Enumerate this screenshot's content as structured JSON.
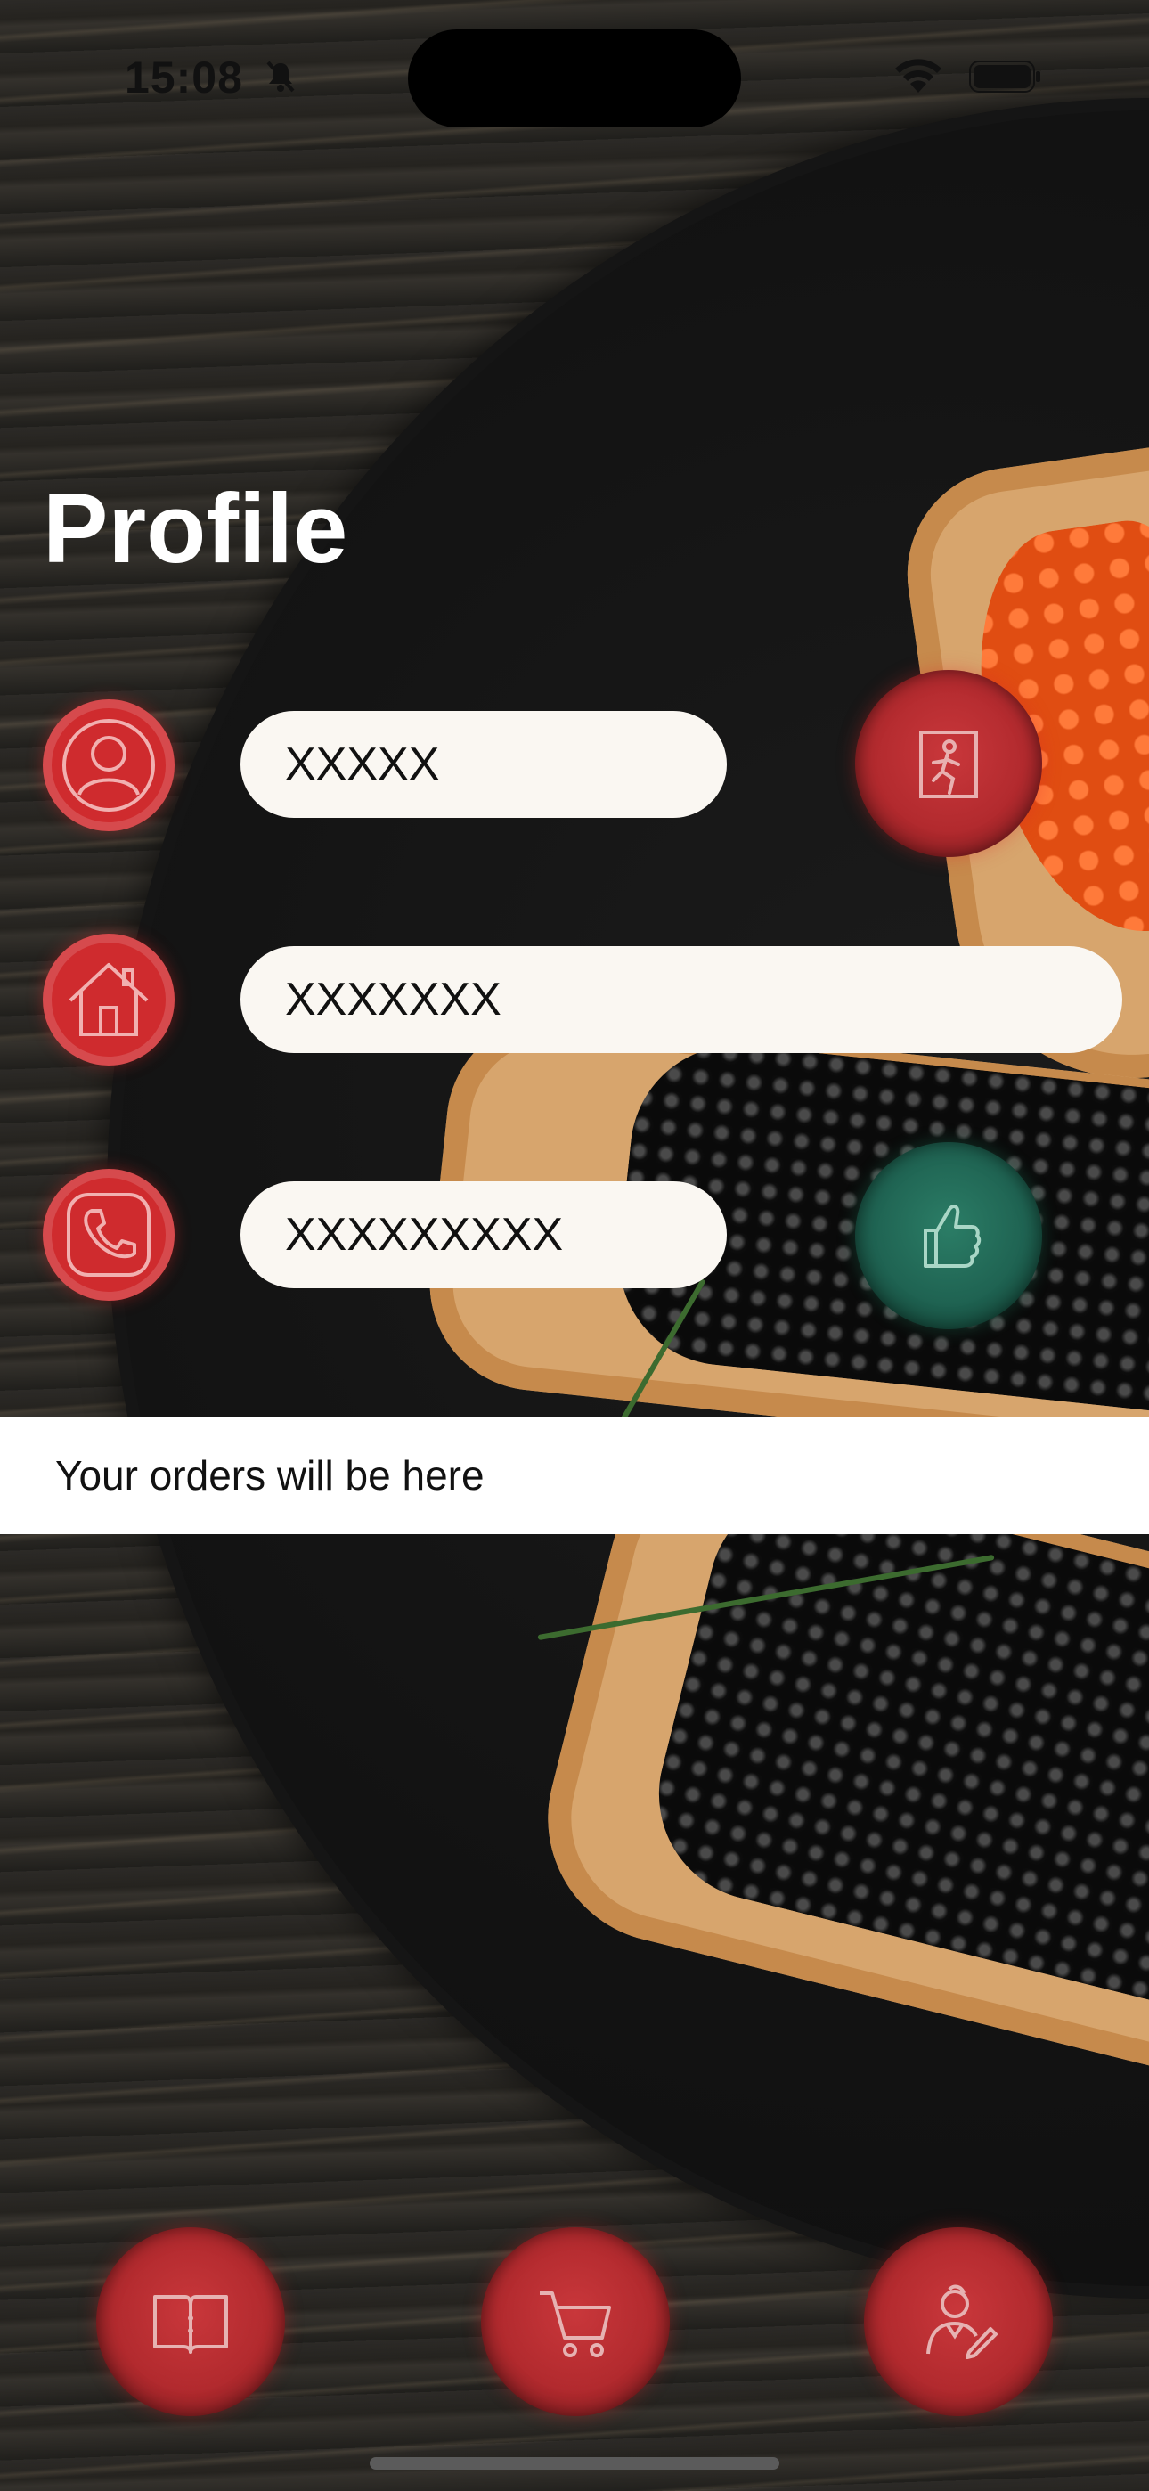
{
  "status_bar": {
    "time": "15:08"
  },
  "header": {
    "title": "Profile"
  },
  "profile": {
    "name_value": "XXXXX",
    "address_value": "XXXXXXX",
    "phone_value": "XXXXXXXXX"
  },
  "orders": {
    "empty_text": "Your orders will be here"
  },
  "icons": {
    "user": "user-icon",
    "home": "home-icon",
    "phone": "phone-icon",
    "exit": "exit-icon",
    "confirm": "thumbs-up-icon",
    "menu": "menu-book-icon",
    "cart": "cart-icon",
    "chef": "chef-icon"
  },
  "colors": {
    "accent_red": "#cf2b2e",
    "accent_green": "#1f6352",
    "field_bg": "#faf7f2"
  }
}
